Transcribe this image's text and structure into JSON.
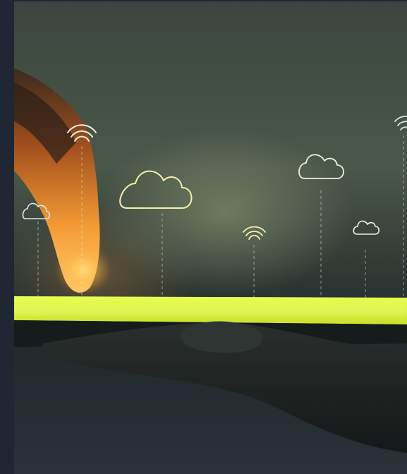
{
  "image": {
    "subject": "hand-holding-glowing-phone",
    "icons": [
      "cloud-icon",
      "wifi-icon"
    ],
    "colors": {
      "frame": "#1e2733",
      "screen_glow": "#d8f23a",
      "finger_glow": "#f08a2a",
      "cloud_outline_warm": "#f4efb0",
      "cloud_outline_cool": "#dfe8ef"
    }
  }
}
